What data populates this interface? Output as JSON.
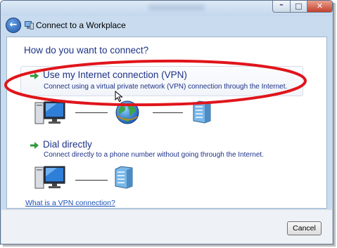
{
  "window": {
    "nav_title": "Connect to a Workplace",
    "title_buttons": {
      "minimize": "–",
      "maximize": "□",
      "close": "✕"
    },
    "back": "←"
  },
  "main": {
    "heading": "How do you want to connect?",
    "options": [
      {
        "title": "Use my Internet connection (VPN)",
        "description": "Connect using a virtual private network (VPN) connection through the Internet.",
        "highlighted": true,
        "icons": [
          "computer-icon",
          "globe-icon",
          "server-icon"
        ]
      },
      {
        "title": "Dial directly",
        "description": "Connect directly to a phone number without going through the Internet.",
        "highlighted": false,
        "icons": [
          "computer-icon",
          "server-icon"
        ]
      }
    ],
    "help_link": "What is a VPN connection?"
  },
  "footer": {
    "cancel_label": "Cancel"
  },
  "colors": {
    "accent": "#1e3287",
    "link": "#1a4fb5",
    "annotation": "#e0151b",
    "arrow": "#2e9b3b"
  }
}
